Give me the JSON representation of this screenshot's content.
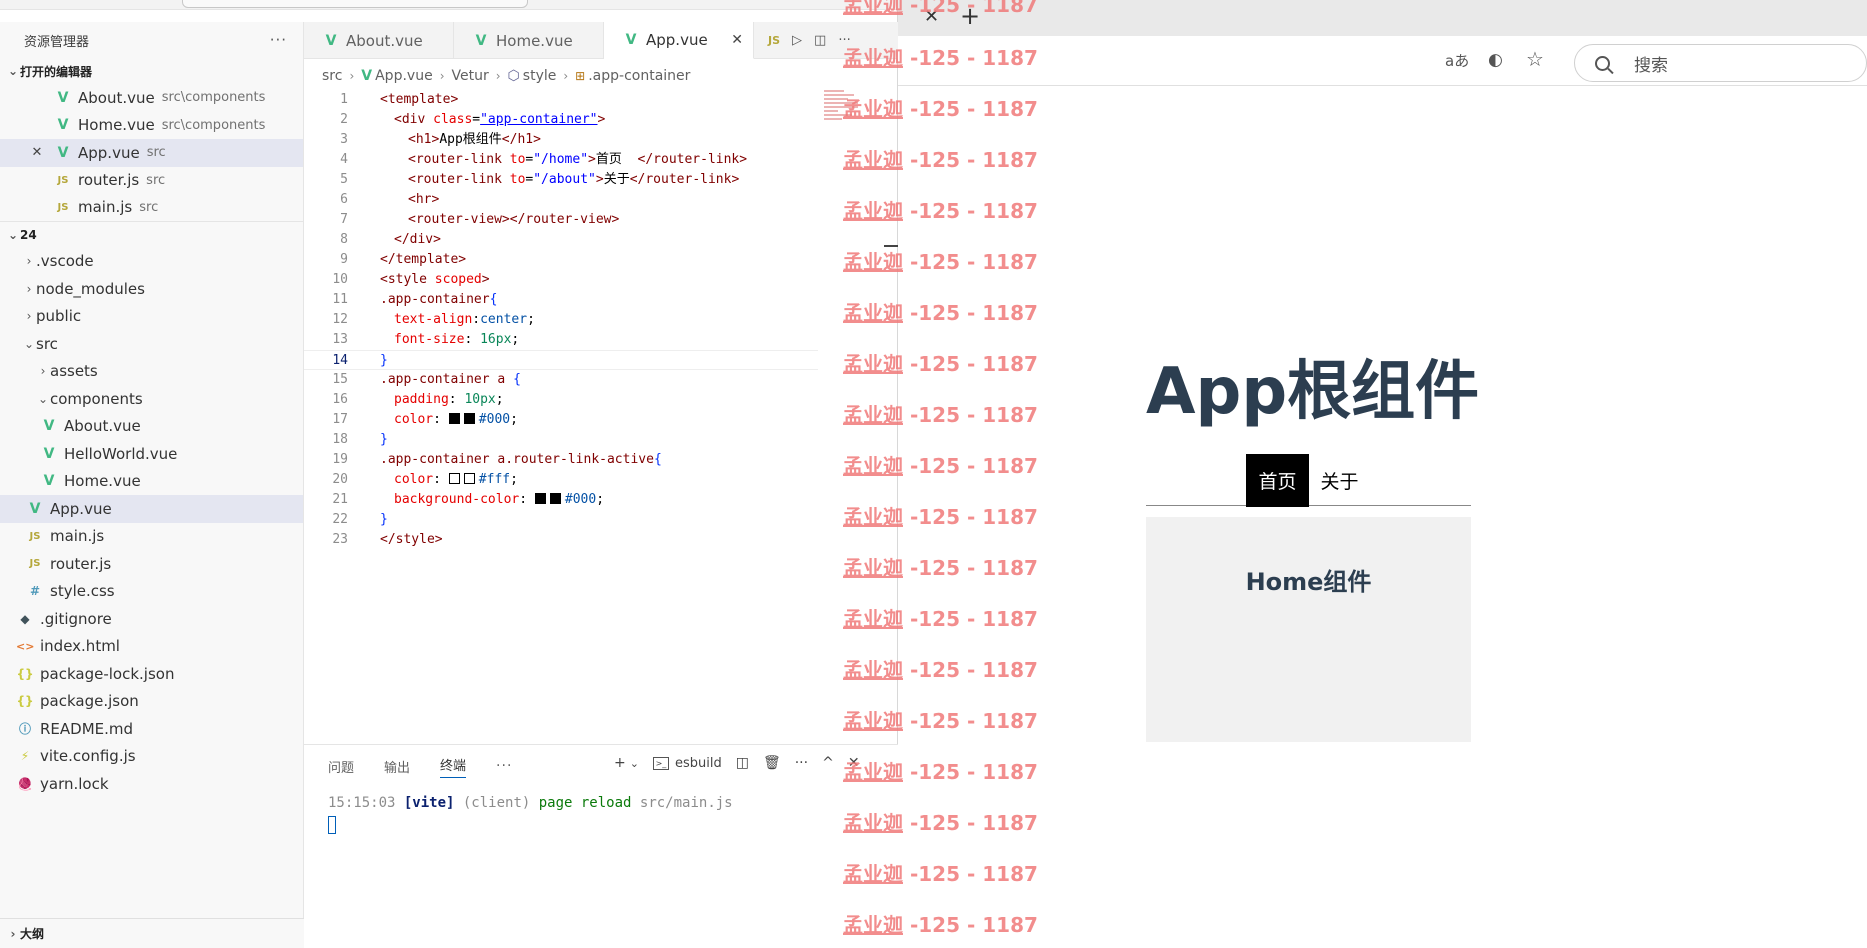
{
  "explorer": {
    "title": "资源管理器",
    "more": "···",
    "open_editors_title": "打开的编辑器",
    "open_editors": [
      {
        "icon": "V",
        "name": "About.vue",
        "desc": "src\\components"
      },
      {
        "icon": "V",
        "name": "Home.vue",
        "desc": "src\\components"
      },
      {
        "icon": "V",
        "name": "App.vue",
        "desc": "src",
        "close": "✕"
      },
      {
        "icon": "JS",
        "name": "router.js",
        "desc": "src"
      },
      {
        "icon": "JS",
        "name": "main.js",
        "desc": "src"
      }
    ],
    "project_title": "24",
    "tree": [
      {
        "icon": "›",
        "name": ".vscode"
      },
      {
        "icon": "›",
        "name": "node_modules"
      },
      {
        "icon": "›",
        "name": "public"
      },
      {
        "icon": "⌄",
        "name": "src"
      },
      {
        "icon": "›",
        "name": "assets"
      },
      {
        "icon": "⌄",
        "name": "components"
      },
      {
        "icon": "V",
        "name": "About.vue"
      },
      {
        "icon": "V",
        "name": "HelloWorld.vue"
      },
      {
        "icon": "V",
        "name": "Home.vue"
      },
      {
        "icon": "V",
        "name": "App.vue"
      },
      {
        "icon": "JS",
        "name": "main.js"
      },
      {
        "icon": "JS",
        "name": "router.js"
      },
      {
        "icon": "#",
        "name": "style.css"
      },
      {
        "icon": "◆",
        "name": ".gitignore"
      },
      {
        "icon": "<>",
        "name": "index.html"
      },
      {
        "icon": "{}",
        "name": "package-lock.json"
      },
      {
        "icon": "{}",
        "name": "package.json"
      },
      {
        "icon": "ⓘ",
        "name": "README.md"
      },
      {
        "icon": "⚡",
        "name": "vite.config.js"
      },
      {
        "icon": "🧶",
        "name": "yarn.lock"
      }
    ],
    "outline_title": "大纲"
  },
  "tabs": [
    {
      "icon": "V",
      "label": "About.vue"
    },
    {
      "icon": "V",
      "label": "Home.vue"
    },
    {
      "icon": "V",
      "label": "App.vue",
      "close": "✕"
    }
  ],
  "tab_more": {
    "js": "JS",
    "run": "▷",
    "split": "◫",
    "more": "···"
  },
  "breadcrumb": {
    "src": "src",
    "file": "App.vue",
    "vetur": "Vetur",
    "style": "style",
    "cls": ".app-container",
    "sep": "›",
    "file_icon": "V",
    "style_icon": "⬡",
    "cls_icon": "⊞"
  },
  "code": {
    "n": [
      "1",
      "2",
      "3",
      "4",
      "5",
      "6",
      "7",
      "8",
      "9",
      "10",
      "11",
      "12",
      "13",
      "14",
      "15",
      "16",
      "17",
      "18",
      "19",
      "20",
      "21",
      "22",
      "23"
    ],
    "l1": {
      "a": "<template>"
    },
    "l2": {
      "a": "<div ",
      "b": "class",
      "c": "=",
      "d": "\"app-container\"",
      "e": ">"
    },
    "l3": {
      "a": "<h1>",
      "b": "App根组件",
      "c": "</h1>"
    },
    "l4": {
      "a": "<router-link ",
      "b": "to",
      "c": "=",
      "d": "\"/home\"",
      "e": ">",
      "f": "首页  ",
      "g": "</router-link>"
    },
    "l5": {
      "a": "<router-link ",
      "b": "to",
      "c": "=",
      "d": "\"/about\"",
      "e": ">",
      "f": "关于",
      "g": "</router-link>"
    },
    "l6": {
      "a": "<hr>"
    },
    "l7": {
      "a": "<router-view></router-view>"
    },
    "l8": {
      "a": "</div>"
    },
    "l9": {
      "a": "</template>"
    },
    "l10": {
      "a": "<style ",
      "b": "scoped",
      "c": ">"
    },
    "l11": {
      "a": ".app-container",
      "b": "{"
    },
    "l12": {
      "a": "text-align",
      "b": ":",
      "c": "center",
      "d": ";"
    },
    "l13": {
      "a": "font-size",
      "b": ": ",
      "c": "16px",
      "d": ";"
    },
    "l14": {
      "a": "}"
    },
    "l15": {
      "a": ".app-container a ",
      "b": "{"
    },
    "l16": {
      "a": "padding",
      "b": ": ",
      "c": "10px",
      "d": ";"
    },
    "l17": {
      "a": "color",
      "b": ": ",
      "c": "#000",
      "d": ";"
    },
    "l18": {
      "a": "}"
    },
    "l19": {
      "a": ".app-container a.router-link-active",
      "b": "{"
    },
    "l20": {
      "a": "color",
      "b": ": ",
      "c": "#fff",
      "d": ";"
    },
    "l21": {
      "a": "background-color",
      "b": ": ",
      "c": "#000",
      "d": ";"
    },
    "l22": {
      "a": "}"
    },
    "l23": {
      "a": "</style>"
    }
  },
  "panel": {
    "tabs": [
      "问题",
      "输出",
      "终端"
    ],
    "more": "···",
    "terminal_name": "esbuild",
    "actions": {
      "add": "+",
      "caret": "⌄",
      "split": "◫",
      "trash": "🗑",
      "more": "···",
      "up": "^",
      "close": "✕"
    },
    "terminal": {
      "time": "15:15:03 ",
      "vite": "[vite]",
      "client": " (client) ",
      "msg": "page reload ",
      "path": "src/main.js"
    }
  },
  "browser": {
    "tab_close": "✕",
    "new_tab": "+",
    "read_aloud": "aあ",
    "search_placeholder": "搜索",
    "icons": [
      "read-aloud-icon",
      "edge-icon",
      "favorite-star-icon",
      "search-icon"
    ]
  },
  "page": {
    "heading": "App根组件",
    "nav": [
      "首页",
      "关于"
    ],
    "home_text": "Home组件"
  },
  "watermark": {
    "name": "孟业迦",
    "num": " -125 - 1187"
  },
  "colors": {
    "vue_green": "#41b883",
    "accent_blue": "#005fb8",
    "watermark": "#f07a7a",
    "heading": "#2c3e50"
  }
}
